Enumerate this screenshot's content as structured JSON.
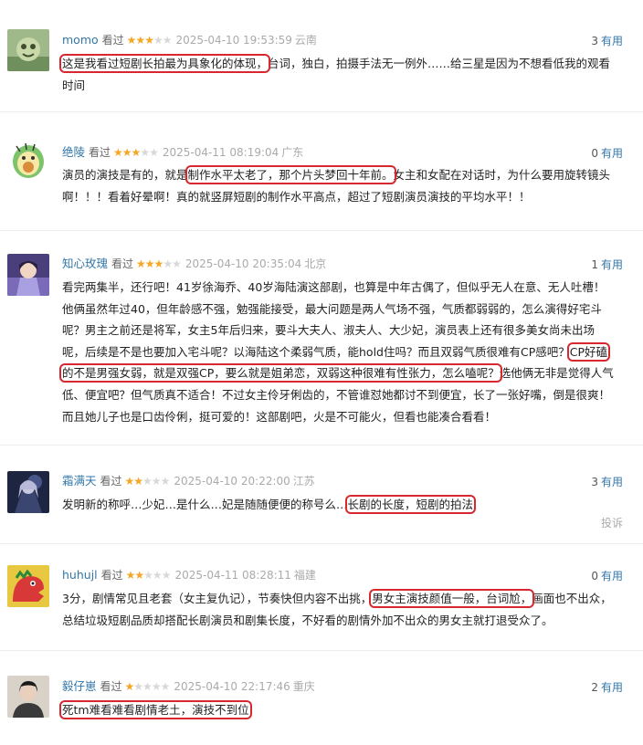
{
  "useful_label": "有用",
  "watched_label": "看过",
  "report_label": "投诉",
  "colors": {
    "username": "#3377aa",
    "star": "#f5a623",
    "highlight": "#d7282f"
  },
  "reviews": [
    {
      "username": "momo",
      "stars": "★★★",
      "stars_off": "★★",
      "rating": 3,
      "time": "2025-04-10 19:53:59",
      "location": "云南",
      "useful": "3",
      "avatar_icon": "green-cartoon-avatar-icon",
      "parts": [
        "",
        "这是我看过短剧长拍最为具象化的体现，",
        "台词，独白，拍摄手法无一例外……给三星是因为不想看低我的观看时间"
      ]
    },
    {
      "username": "绝陵",
      "stars": "★★★",
      "stars_off": "★★",
      "rating": 3,
      "time": "2025-04-11 08:19:04",
      "location": "广东",
      "useful": "0",
      "avatar_icon": "avocado-cartoon-avatar-icon",
      "parts": [
        "演员的演技是有的，就是",
        "制作水平太老了，那个片头梦回十年前。",
        "女主和女配在对话时，为什么要用旋转镜头啊！！！看着好晕啊！真的就竖屏短剧的制作水平高点，超过了短剧演员演技的平均水平！！"
      ]
    },
    {
      "username": "知心玫瑰",
      "stars": "★★★",
      "stars_off": "★★",
      "rating": 3,
      "time": "2025-04-10 20:35:04",
      "location": "北京",
      "useful": "1",
      "avatar_icon": "anime-character-avatar-icon",
      "parts": [
        "看完两集半，还行吧！41岁徐海乔、40岁海陆演这部剧，也算是中年古偶了，但似乎无人在意、无人吐槽！他俩虽然年过40，但年龄感不强，勉强能接受，最大问题是两人气场不强，气质都弱弱的，怎么演得好宅斗呢？男主之前还是将军，女主5年后归来，要斗大夫人、淑夫人、大少妃，演员表上还有很多美女尚未出场呢，后续是不是也要加入宅斗呢？以海陆这个柔弱气质，能hold住吗？而且双弱气质很难有CP感吧？",
        "CP好磕的不是男强女弱，就是双强CP，要么就是姐弟恋，双弱这种很难有性张力，怎么嗑呢？",
        "选他俩无非是觉得人气低、便宜吧？但气质真不适合！不过女主伶牙俐齿的，不管谁怼她都讨不到便宜，长了一张好嘴，倒是很爽！而且她儿子也是口齿伶俐，挺可爱的！这部剧吧，火是不可能火，但看也能凑合看看！"
      ]
    },
    {
      "username": "霜满天",
      "stars": "★★",
      "stars_off": "★★★",
      "rating": 2,
      "time": "2025-04-10 20:22:00",
      "location": "江苏",
      "useful": "3",
      "avatar_icon": "dark-anime-avatar-icon",
      "parts": [
        "发明新的称呼…少妃…是什么…妃是随随便便的称号么…",
        "长剧的长度，短剧的拍法",
        ""
      ]
    },
    {
      "username": "huhujl",
      "stars": "★★",
      "stars_off": "★★★",
      "rating": 2,
      "time": "2025-04-11 08:28:11",
      "location": "福建",
      "useful": "0",
      "avatar_icon": "red-dinosaur-avatar-icon",
      "parts": [
        "3分，剧情常见且老套（女主复仇记），节奏快但内容不出挑，",
        "男女主演技颜值一般，台词尬，",
        "画面也不出众，总结垃圾短剧品质却搭配长剧演员和剧集长度，不好看的剧情外加不出众的男女主就打退受众了。"
      ]
    },
    {
      "username": "毅仔崽",
      "stars": "★",
      "stars_off": "★★★★",
      "rating": 1,
      "time": "2025-04-10 22:17:46",
      "location": "重庆",
      "useful": "2",
      "avatar_icon": "portrait-photo-avatar-icon",
      "parts": [
        "",
        "死tm难看难看剧情老土，演技不到位",
        ""
      ]
    }
  ]
}
